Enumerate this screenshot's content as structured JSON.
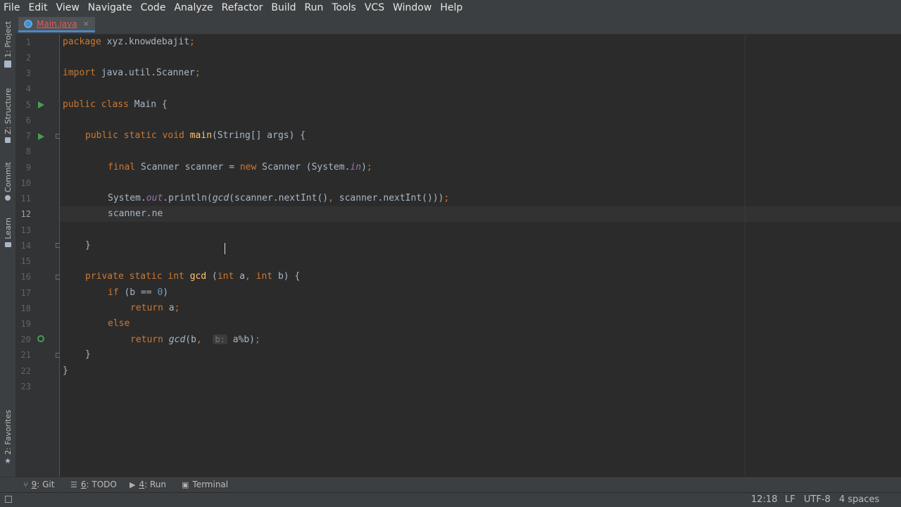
{
  "menu": [
    "File",
    "Edit",
    "View",
    "Navigate",
    "Code",
    "Analyze",
    "Refactor",
    "Build",
    "Run",
    "Tools",
    "VCS",
    "Window",
    "Help"
  ],
  "left_toolwindows": {
    "project": "1: Project",
    "structure": "Z: Structure",
    "commit": "Commit",
    "learn": "Learn",
    "favorites": "2: Favorites"
  },
  "editor_tab": {
    "label": "Main.java",
    "close": "×",
    "icon": "java-class-icon"
  },
  "line_numbers": [
    "1",
    "2",
    "3",
    "4",
    "5",
    "6",
    "7",
    "8",
    "9",
    "10",
    "11",
    "12",
    "13",
    "14",
    "15",
    "16",
    "17",
    "18",
    "19",
    "20",
    "21",
    "22",
    "23"
  ],
  "code": {
    "l1_kw": "package",
    "l1_name": " xyz.knowdebajit",
    "l1_semi": ";",
    "l3_kw": "import",
    "l3_name": " java.util.Scanner",
    "l3_semi": ";",
    "l5_kw": "public class",
    "l5_rest": " Main {",
    "l7_kw": "public static void",
    "l7_fn": "main",
    "l7_rest": "(String[] args) {",
    "l9_kw": "final",
    "l9_mid": " Scanner scanner = ",
    "l9_kw2": "new",
    "l9_mid2": " Scanner (System.",
    "l9_field": "in",
    "l9_end": ")",
    "l9_semi": ";",
    "l11_a": "System.",
    "l11_field": "out",
    "l11_b": ".println(",
    "l11_call": "gcd",
    "l11_c": "(scanner.nextInt()",
    "l11_comma": ",",
    "l11_d": " scanner.nextInt()))",
    "l11_semi": ";",
    "l12": "scanner.ne",
    "l14": "}",
    "l16_kw": "private static int",
    "l16_fn": "gcd",
    "l16_a": " (",
    "l16_kw2": "int",
    "l16_b": " a",
    "l16_comma": ",",
    "l16_kw3": "int",
    "l16_c": " b) {",
    "l17_kw": "if",
    "l17_a": " (b == ",
    "l17_num": "0",
    "l17_b": ")",
    "l18_kw": "return",
    "l18_a": " a",
    "l18_semi": ";",
    "l19_kw": "else",
    "l20_kw": "return",
    "l20_call": "gcd",
    "l20_a": "(b",
    "l20_comma": ",",
    "l20_hint": "b:",
    "l20_b": " a%b)",
    "l20_semi": ";",
    "l21": "}",
    "l22": "}"
  },
  "bottom_toolwindows": {
    "git_num": "9",
    "git_label": ": Git",
    "todo_num": "6",
    "todo_label": ": TODO",
    "run_num": "4",
    "run_label": ": Run",
    "terminal_label": "Terminal"
  },
  "status": {
    "position": "12:18",
    "line_separator": "LF",
    "encoding": "UTF-8",
    "indent": "4 spaces"
  },
  "colors": {
    "background": "#2b2b2b",
    "keyword": "#cc7832",
    "function": "#ffc66d",
    "static_field": "#9876aa",
    "number": "#6897bb",
    "run_icon": "#499c54",
    "error_tab": "#e05c5c"
  }
}
